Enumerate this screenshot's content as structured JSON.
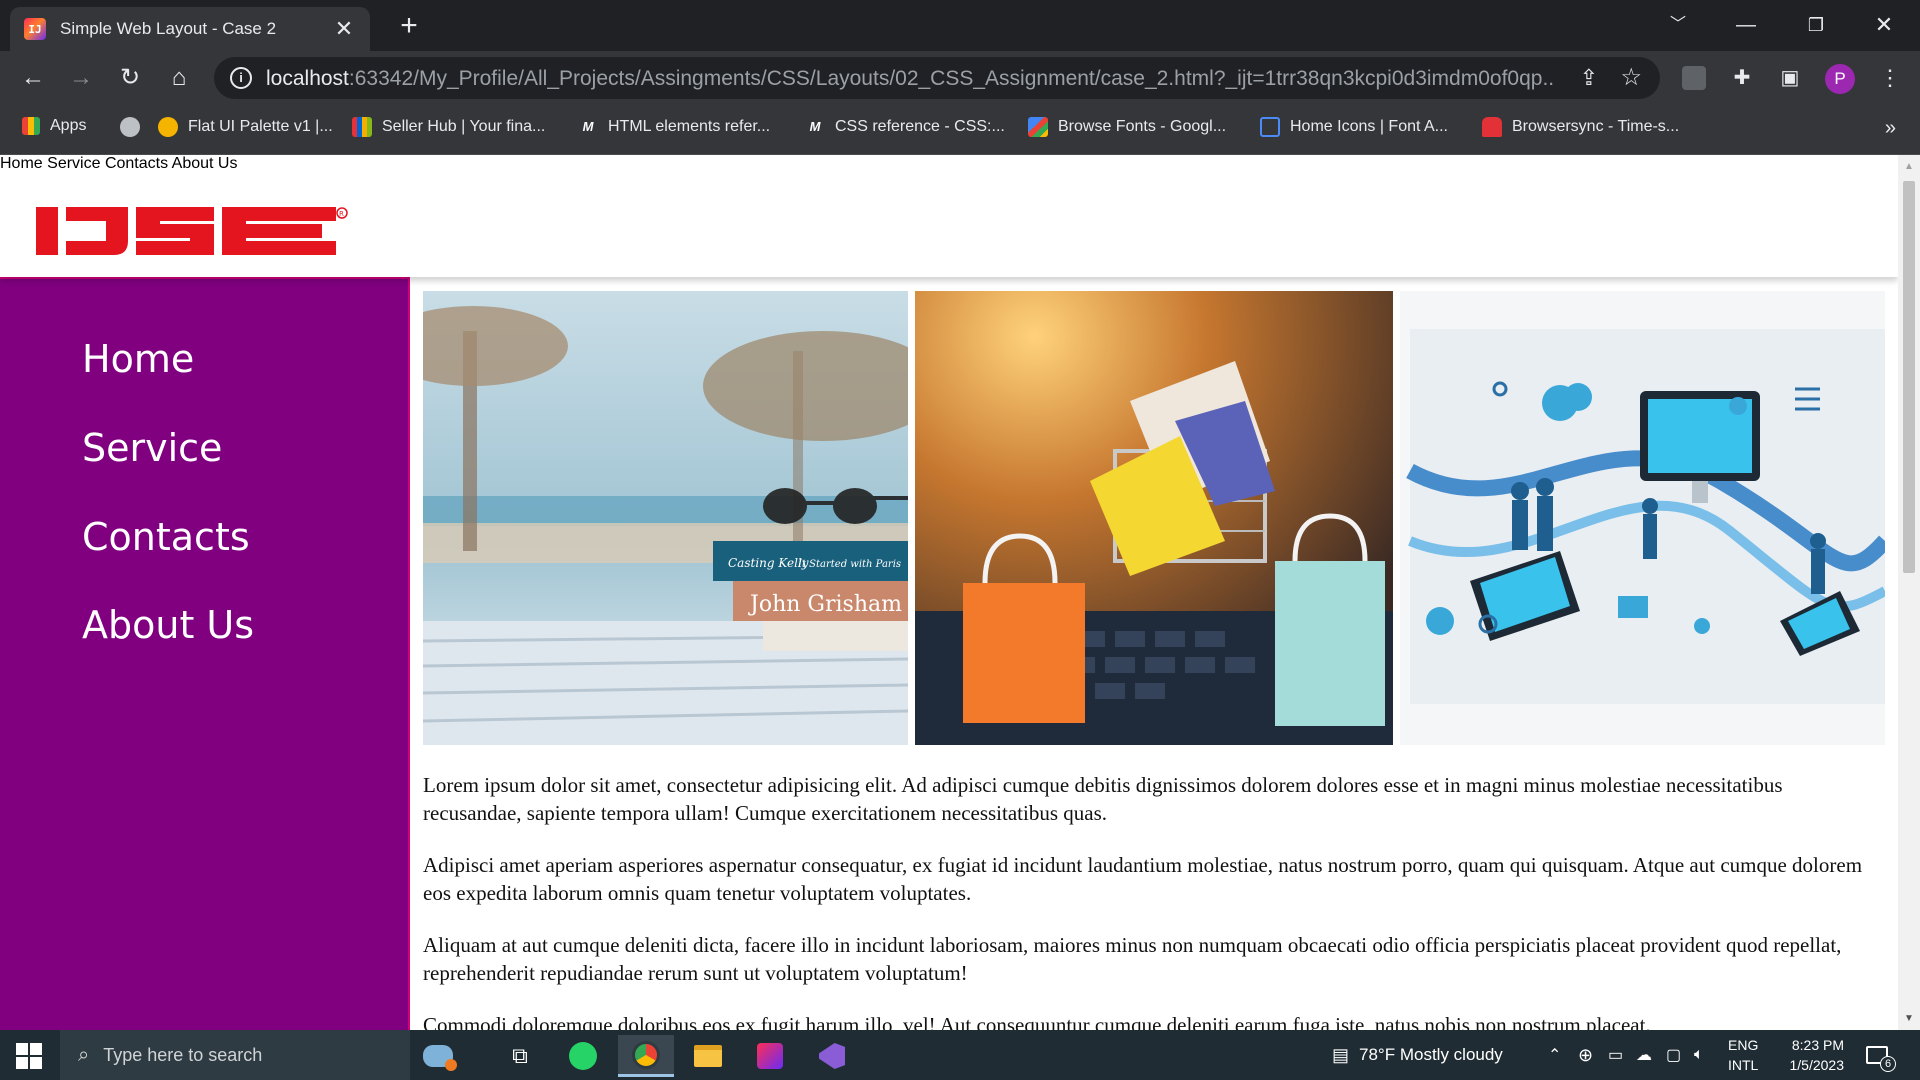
{
  "browser": {
    "tab_title": "Simple Web Layout - Case 2",
    "tab_close": "✕",
    "new_tab": "+",
    "url_host": "localhost",
    "url_rest": ":63342/My_Profile/All_Projects/Assingments/CSS/Layouts/02_CSS_Assignment/case_2.html?_ijt=1trr38qn3kcpi0d3imdm0of0qp...",
    "profile_initial": "P",
    "bookmarks": [
      {
        "label": "Apps",
        "icon": "apps-grid-icon"
      },
      {
        "label": "",
        "icon": "globe-icon"
      },
      {
        "label": "Flat UI Palette v1 |...",
        "icon": "palette-icon"
      },
      {
        "label": "Seller Hub | Your fina...",
        "icon": "seller-hub-icon"
      },
      {
        "label": "HTML elements refer...",
        "icon": "mdn-icon"
      },
      {
        "label": "CSS reference - CSS:...",
        "icon": "mdn-icon"
      },
      {
        "label": "Browse Fonts - Googl...",
        "icon": "google-fonts-icon"
      },
      {
        "label": "Home Icons | Font A...",
        "icon": "font-awesome-flag-icon"
      },
      {
        "label": "Browsersync - Time-s...",
        "icon": "browsersync-icon"
      }
    ]
  },
  "site": {
    "logo_text": "IJSE",
    "brand_color": "#e4151f",
    "sidebar_color": "#800080",
    "top_nav": [
      "Home",
      "Service",
      "Contacts",
      "About Us"
    ],
    "side_nav": [
      "Home",
      "Service",
      "Contacts",
      "About Us"
    ],
    "paragraphs": [
      "Lorem ipsum dolor sit amet, consectetur adipisicing elit. Ad adipisci cumque debitis dignissimos dolorem dolores esse et in magni minus molestiae necessitatibus recusandae, sapiente tempora ullam! Cumque exercitationem necessitatibus quas.",
      "Adipisci amet aperiam asperiores aspernatur consequatur, ex fugiat id incidunt laudantium molestiae, natus nostrum porro, quam qui quisquam. Atque aut cumque dolorem eos expedita laborum omnis quam tenetur voluptatem voluptates.",
      "Aliquam at aut cumque deleniti dicta, facere illo in incidunt laboriosam, maiores minus non numquam obcaecati odio officia perspiciatis placeat provident quod repellat, reprehenderit repudiandae rerum sunt ut voluptatem voluptatum!",
      "Commodi doloremque doloribus eos ex fugit harum illo, vel! Aut consequuntur cumque deleniti earum fuga iste, natus nobis non nostrum placeat."
    ],
    "book_spine_1": "Casting Kelly",
    "book_spine_1b": "It Started with Paris",
    "book_spine_2": "John Grisham"
  },
  "taskbar": {
    "search_placeholder": "Type here to search",
    "weather": "78°F  Mostly cloudy",
    "lang_1": "ENG",
    "lang_2": "INTL",
    "time": "8:23 PM",
    "date": "1/5/2023",
    "notification_count": "6"
  }
}
